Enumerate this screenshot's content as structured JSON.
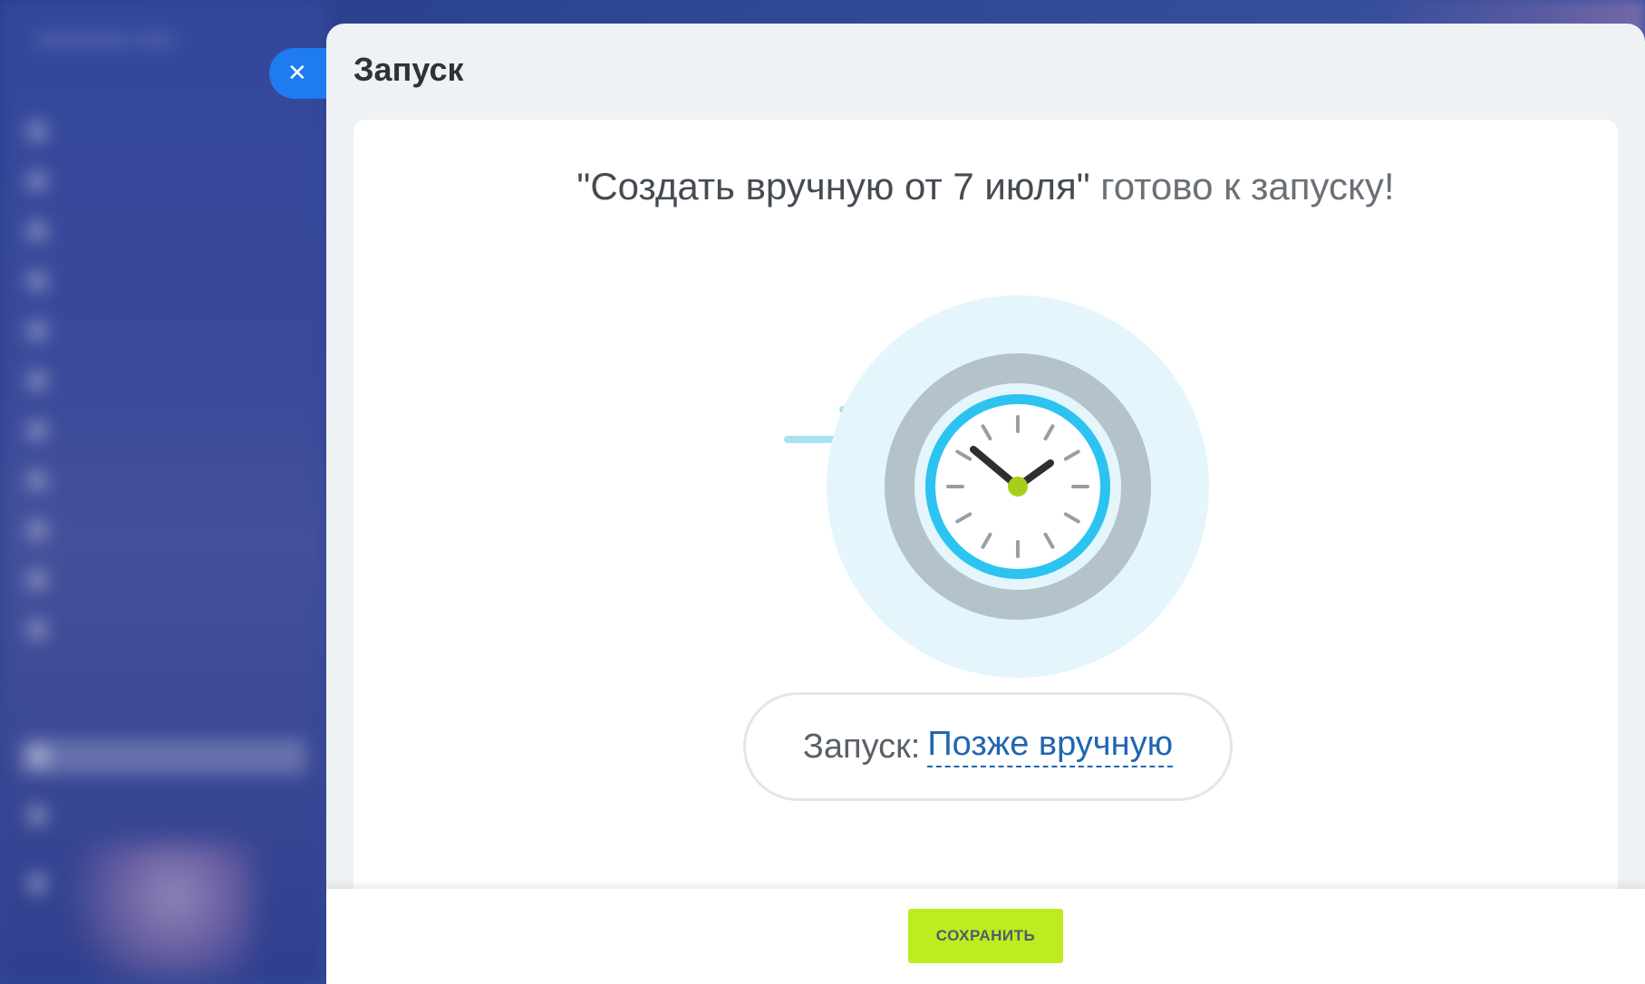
{
  "panel": {
    "title": "Запуск",
    "close_icon": "✕"
  },
  "card": {
    "heading_strong": "\"Создать вручную от 7 июля\"",
    "heading_light": "готово к запуску!",
    "illustration_icon": "clock-icon",
    "launch_label": "Запуск:",
    "launch_value": "Позже вручную"
  },
  "footer": {
    "save_label": "СОХРАНИТЬ"
  },
  "colors": {
    "accent_blue": "#1e7bf0",
    "link_blue": "#2066b0",
    "save_green": "#bbed21",
    "clock_ring": "#2cc3f0",
    "clock_center": "#a6cf1a"
  }
}
